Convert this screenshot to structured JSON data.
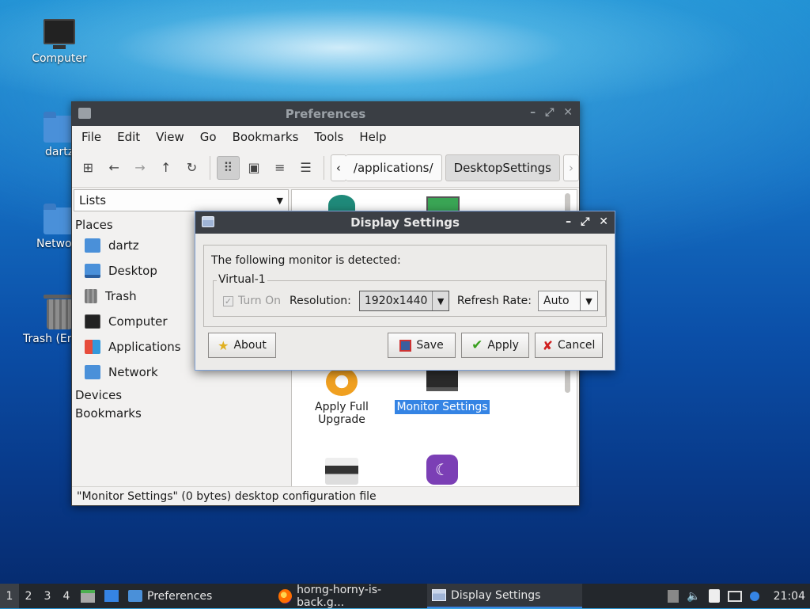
{
  "desktop": {
    "icons": [
      {
        "label": "Computer"
      },
      {
        "label": "dartz"
      },
      {
        "label": "Netwo"
      },
      {
        "label": "Trash (En"
      }
    ]
  },
  "file_manager": {
    "title": "Preferences",
    "menu": [
      "File",
      "Edit",
      "View",
      "Go",
      "Bookmarks",
      "Tools",
      "Help"
    ],
    "path": [
      "/applications/",
      "DesktopSettings"
    ],
    "side_view": "Lists",
    "sections": {
      "places": "Places",
      "devices": "Devices",
      "bookmarks": "Bookmarks"
    },
    "places": [
      "dartz",
      "Desktop",
      "Trash",
      "Computer",
      "Applications",
      "Network"
    ],
    "items": [
      {
        "label": "Apply Full Upgrade"
      },
      {
        "label": "Monitor Settings"
      }
    ],
    "status": "\"Monitor Settings\" (0 bytes) desktop configuration file"
  },
  "dialog": {
    "title": "Display Settings",
    "detected": "The following monitor is detected:",
    "monitor": "Virtual-1",
    "turn_on": "Turn On",
    "resolution_label": "Resolution:",
    "resolution": "1920x1440",
    "refresh_label": "Refresh Rate:",
    "refresh": "Auto",
    "buttons": {
      "about": "About",
      "save": "Save",
      "apply": "Apply",
      "cancel": "Cancel"
    }
  },
  "taskbar": {
    "workspaces": [
      "1",
      "2",
      "3",
      "4"
    ],
    "tasks": [
      "Preferences",
      "horng-horny-is-back.g...",
      "Display Settings"
    ],
    "clock": "21:04"
  },
  "colors": {
    "accent": "#3584e4",
    "titlebar": "#3b3f45"
  }
}
